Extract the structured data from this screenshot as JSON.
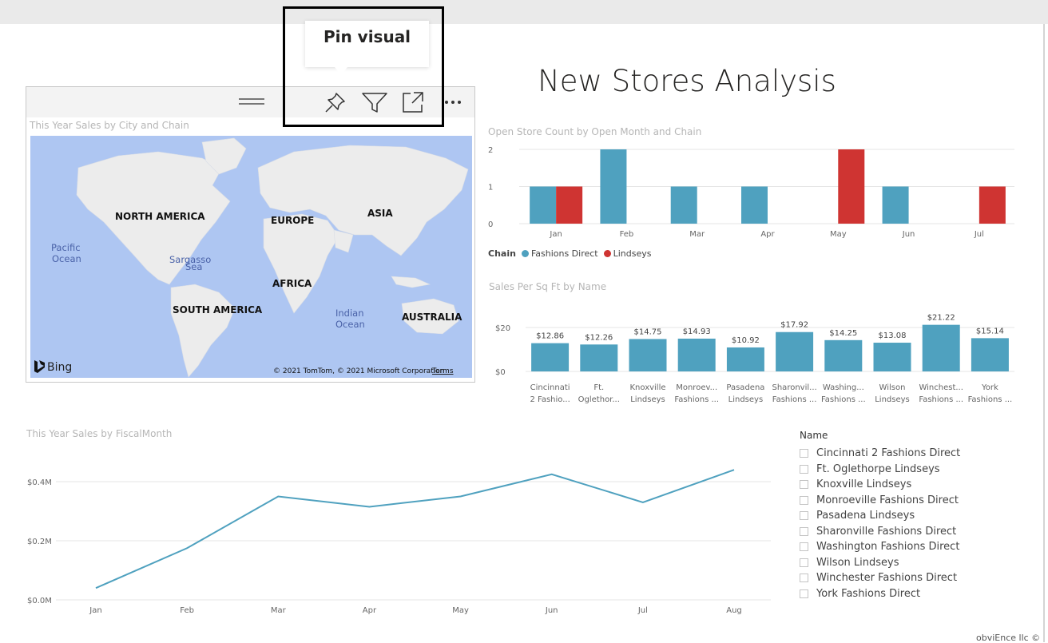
{
  "report": {
    "title": "New Stores Analysis",
    "footer": "obviEnce llc ©"
  },
  "tooltip": {
    "text": "Pin visual"
  },
  "visual_header": {
    "icons": [
      {
        "name": "pin-icon"
      },
      {
        "name": "filter-icon"
      },
      {
        "name": "focus-mode-icon"
      },
      {
        "name": "more-options-icon"
      }
    ]
  },
  "map": {
    "title": "This Year Sales by City and Chain",
    "labels": {
      "north_america": "NORTH AMERICA",
      "europe": "EUROPE",
      "asia": "ASIA",
      "pacific_1": "Pacific",
      "pacific_2": "Ocean",
      "sargasso_1": "Sargasso",
      "sargasso_2": "Sea",
      "africa": "AFRICA",
      "south_america": "SOUTH AMERICA",
      "indian_1": "Indian",
      "indian_2": "Ocean",
      "australia": "AUSTRALIA"
    },
    "brand": "Bing",
    "copyright": "© 2021 TomTom, © 2021 Microsoft Corporation",
    "terms": "Terms",
    "colors": {
      "ocean": "#aec6f2",
      "land": "#ececec"
    }
  },
  "chart_data": [
    {
      "type": "bar",
      "title": "Open Store Count by Open Month and Chain",
      "categories": [
        "Jan",
        "Feb",
        "Mar",
        "Apr",
        "May",
        "Jun",
        "Jul"
      ],
      "series": [
        {
          "name": "Fashions Direct",
          "color": "#4fa1bf",
          "values": [
            1,
            2,
            1,
            1,
            0,
            1,
            0
          ]
        },
        {
          "name": "Lindseys",
          "color": "#cf3432",
          "values": [
            1,
            0,
            0,
            0,
            2,
            0,
            1
          ]
        }
      ],
      "yticks": [
        "0",
        "1",
        "2"
      ],
      "ylim": [
        0,
        2
      ],
      "legend": {
        "title": "Chain",
        "position": "bottom-left"
      }
    },
    {
      "type": "bar",
      "title": "Sales Per Sq Ft by Name",
      "categories": [
        [
          "Cincinnati",
          "2 Fashio..."
        ],
        [
          "Ft.",
          "Oglethor..."
        ],
        [
          "Knoxville",
          "Lindseys"
        ],
        [
          "Monroev...",
          "Fashions ..."
        ],
        [
          "Pasadena",
          "Lindseys"
        ],
        [
          "Sharonvil...",
          "Fashions ..."
        ],
        [
          "Washing...",
          "Fashions ..."
        ],
        [
          "Wilson",
          "Lindseys"
        ],
        [
          "Winchest...",
          "Fashions ..."
        ],
        [
          "York",
          "Fashions ..."
        ]
      ],
      "values": [
        12.86,
        12.26,
        14.75,
        14.93,
        10.92,
        17.92,
        14.25,
        13.08,
        21.22,
        15.14
      ],
      "data_labels": [
        "$12.86",
        "$12.26",
        "$14.75",
        "$14.93",
        "$10.92",
        "$17.92",
        "$14.25",
        "$13.08",
        "$21.22",
        "$15.14"
      ],
      "yticks": [
        "$0",
        "$20"
      ],
      "ylim": [
        0,
        20
      ],
      "color": "#4fa1bf"
    },
    {
      "type": "line",
      "title": "This Year Sales by FiscalMonth",
      "categories": [
        "Jan",
        "Feb",
        "Mar",
        "Apr",
        "May",
        "Jun",
        "Jul",
        "Aug"
      ],
      "values": [
        0.04,
        0.175,
        0.35,
        0.315,
        0.35,
        0.425,
        0.33,
        0.44
      ],
      "yticks": [
        "$0.0M",
        "$0.2M",
        "$0.4M"
      ],
      "ylim": [
        0,
        0.4
      ],
      "unit": "M",
      "color": "#4fa1bf"
    }
  ],
  "slicer": {
    "title": "Name",
    "items": [
      "Cincinnati 2 Fashions Direct",
      "Ft. Oglethorpe Lindseys",
      "Knoxville Lindseys",
      "Monroeville Fashions Direct",
      "Pasadena Lindseys",
      "Sharonville Fashions Direct",
      "Washington Fashions Direct",
      "Wilson Lindseys",
      "Winchester Fashions Direct",
      "York Fashions Direct"
    ]
  }
}
